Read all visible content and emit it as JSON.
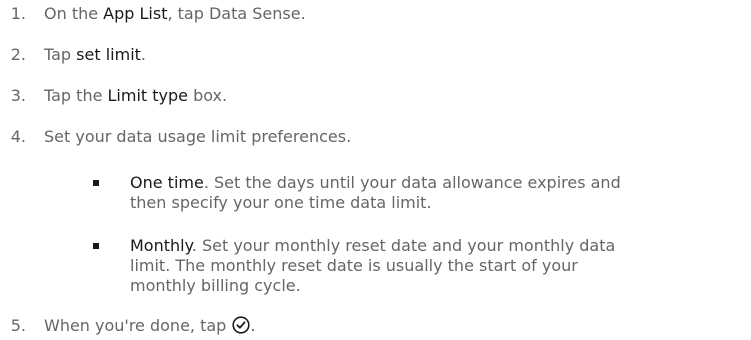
{
  "steps": [
    {
      "num": "1.",
      "before": "On the ",
      "bold": "App List",
      "after": ", tap Data Sense."
    },
    {
      "num": "2.",
      "before": "Tap ",
      "bold": "set limit",
      "after": "."
    },
    {
      "num": "3.",
      "before": "Tap the ",
      "bold": "Limit type",
      "after": " box."
    },
    {
      "num": "4.",
      "text": "Set your data usage limit preferences."
    },
    {
      "num": "5.",
      "before": "When you're done, tap ",
      "after": "."
    }
  ],
  "bullets": [
    {
      "bold": "One time",
      "line1": ". Set the days until your data allowance expires and",
      "line2": "then specify your one time data limit."
    },
    {
      "bold": "Monthly",
      "line1": ". Set your monthly reset date and your monthly data",
      "line2": "limit. The monthly reset date is usually the start of your",
      "line3": "monthly billing cycle."
    }
  ],
  "icons": {
    "done": "check-circle-icon"
  },
  "colors": {
    "text": "#666666",
    "emphasis": "#1a1a1a"
  }
}
